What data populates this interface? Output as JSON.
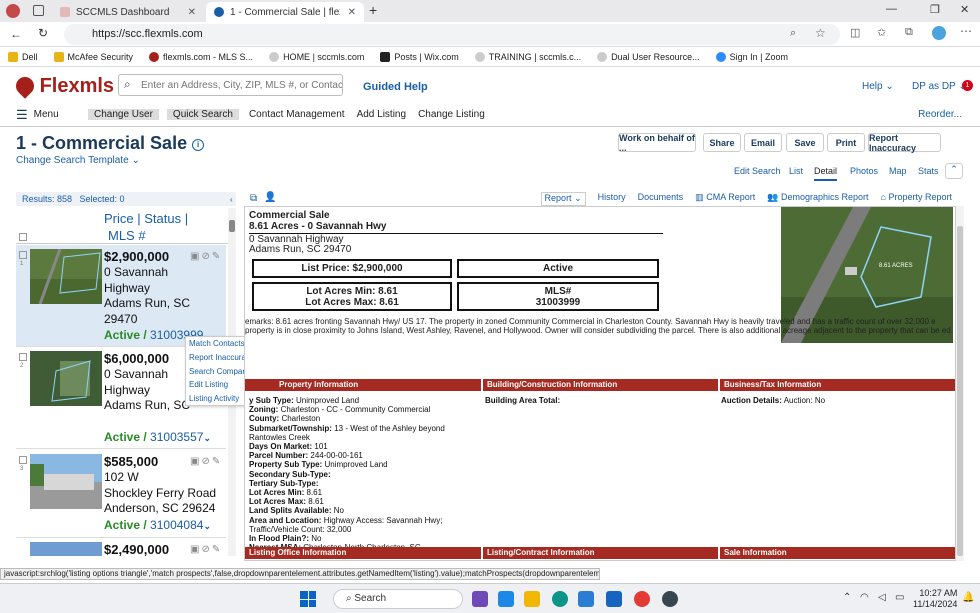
{
  "browser": {
    "tabs": [
      {
        "title": "SCCMLS Dashboard"
      },
      {
        "title": "1 - Commercial Sale | flexmls Web"
      }
    ],
    "url": "https://scc.flexmls.com",
    "bookmarks": [
      "Dell",
      "McAfee Security",
      "flexmls.com - MLS S...",
      "HOME | sccmls.com",
      "Posts | Wix.com",
      "TRAINING | sccmls.c...",
      "Dual User Resource...",
      "Sign In | Zoom"
    ]
  },
  "app": {
    "logo": "Flexmls",
    "search_placeholder": "Enter an Address, City, ZIP, MLS #, or Contact...",
    "guided_help": "Guided Help",
    "help": "Help",
    "user": "DP as DP",
    "badge": "1",
    "menu": {
      "label": "Menu",
      "items": [
        "Change User",
        "Quick Search",
        "Contact Management",
        "Add Listing",
        "Change Listing"
      ],
      "reorder": "Reorder..."
    }
  },
  "page": {
    "title": "1 - Commercial Sale",
    "change_template": "Change Search Template",
    "actions": [
      "Work on behalf of ...",
      "Share",
      "Email",
      "Save",
      "Print",
      "Report Inaccuracy"
    ],
    "view_tabs": [
      "Edit Search",
      "List",
      "Detail",
      "Photos",
      "Map",
      "Stats"
    ],
    "active_tab": "Detail"
  },
  "results": {
    "summary": "Results: 858   Selected: 0",
    "sort_labels": [
      "Price",
      "|",
      "Status",
      "|",
      "MLS #"
    ],
    "items": [
      {
        "num": "1",
        "price": "$2,900,000",
        "addr1": "0 Savannah",
        "addr2": "Highway",
        "addr3": "Adams Run, SC",
        "addr4": "29470",
        "status": "Active",
        "mls": "31003999"
      },
      {
        "num": "2",
        "price": "$6,000,000",
        "addr1": "0 Savannah",
        "addr2": "Highway",
        "addr3": "Adams Run, SC",
        "addr4": "",
        "status": "Active",
        "mls": "31003557"
      },
      {
        "num": "3",
        "price": "$585,000",
        "addr1": "102 W",
        "addr2": "Shockley Ferry Road",
        "addr3": "Anderson, SC 29624",
        "addr4": "",
        "status": "Active",
        "mls": "31004084"
      },
      {
        "num": "4",
        "price": "$2,490,000",
        "addr1": "",
        "addr2": "",
        "addr3": "",
        "addr4": "",
        "status": "",
        "mls": ""
      }
    ]
  },
  "context_menu": [
    "Match Contacts",
    "Report Inaccuracy",
    "Search Comparables",
    "Edit Listing",
    "Listing Activity"
  ],
  "report_toolbar": [
    "Report",
    "History",
    "Documents",
    "CMA Report",
    "Demographics Report",
    "Property Report"
  ],
  "report": {
    "type": "Commercial Sale",
    "heading": "8.61 Acres - 0 Savannah Hwy",
    "addr1": "0 Savannah Highway",
    "addr2": "Adams Run, SC 29470",
    "list_price": "List Price: $2,900,000",
    "status": "Active",
    "lot_min": "Lot Acres Min: 8.61",
    "lot_max": "Lot Acres Max: 8.61",
    "mls_label": "MLS#",
    "mls": "31003999",
    "photo_label": "8.61 ACRES",
    "remarks": "emarks: 8.61 acres fronting Savannah Hwy/ US 17. The property in zoned Community Commercial in Charleston County. Savannah Hwy is heavily traveled and has a traffic count of over 32,000 e property is in close proximity to Johns Island, West Ashley, Ravenel, and Hollywood. Owner will consider subdividing the parcel. There is also additional acreage adjacent to the property that can be ed.",
    "sections": [
      "Property Information",
      "Building/Construction Information",
      "Business/Tax Information"
    ],
    "property_info": [
      {
        "k": "y Sub Type:",
        "v": "Unimproved Land"
      },
      {
        "k": "Zoning:",
        "v": "Charleston - CC - Community Commercial"
      },
      {
        "k": "County:",
        "v": "Charleston"
      },
      {
        "k": "Submarket/Township:",
        "v": "13 - West of the Ashley beyond Rantowles Creek"
      },
      {
        "k": "Days On Market:",
        "v": "101"
      },
      {
        "k": "Parcel Number:",
        "v": "244-00-00-161"
      },
      {
        "k": "Property Sub Type:",
        "v": "Unimproved Land"
      },
      {
        "k": "Secondary Sub-Type:",
        "v": ""
      },
      {
        "k": "Tertiary Sub-Type:",
        "v": ""
      },
      {
        "k": "Lot Acres Min:",
        "v": "8.61"
      },
      {
        "k": "Lot Acres Max:",
        "v": "8.61"
      },
      {
        "k": "Land Splits Available:",
        "v": "No"
      },
      {
        "k": "Area and Location:",
        "v": "Highway Access: Savannah Hwy; Traffic/Vehicle Count: 32,000"
      },
      {
        "k": "In Flood Plain?:",
        "v": "No"
      },
      {
        "k": "Nearest MSA:",
        "v": "Charleston-North Charleston, SC"
      }
    ],
    "building_area": "Building Area Total:",
    "auction_label": "Auction Details:",
    "auction_value": "Auction: No",
    "bottom_sections": [
      "Listing Office Information",
      "Listing/Contract Information",
      "Sale Information"
    ]
  },
  "statusbar": "javascript:srchlog('listing options triangle','match prospects',false,dropdownparentelement.attributes.getNamedItem('listing').value);matchProspects(dropdownparentelement)",
  "taskbar": {
    "search": "Search",
    "time": "10:27 AM",
    "date": "11/14/2024"
  }
}
